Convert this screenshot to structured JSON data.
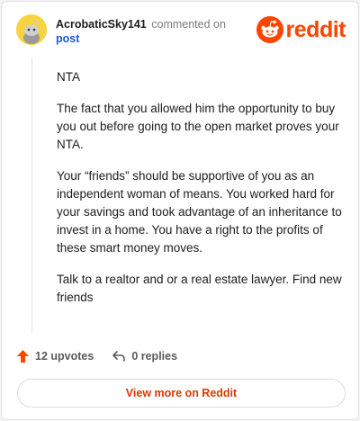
{
  "header": {
    "author": "AcrobaticSky141",
    "action_text": "commented on",
    "post_link": "post",
    "logo_text": "reddit"
  },
  "comment": {
    "paragraphs": [
      "NTA",
      "The fact that you allowed him the opportunity to buy you out before going to the open market proves your NTA.",
      "Your “friends” should be supportive of you as an independent woman of means. You worked hard for your savings and took advantage of an inheritance to invest in a home. You have a right to the profits of these smart money moves.",
      "Talk to a realtor and or a real estate lawyer. Find new friends"
    ]
  },
  "actions": {
    "upvotes": "12 upvotes",
    "replies": "0 replies"
  },
  "footer": {
    "view_more": "View more on Reddit"
  },
  "colors": {
    "brand": "#ff4500",
    "link": "#1c5bd6",
    "avatar": "#f6d33f"
  }
}
